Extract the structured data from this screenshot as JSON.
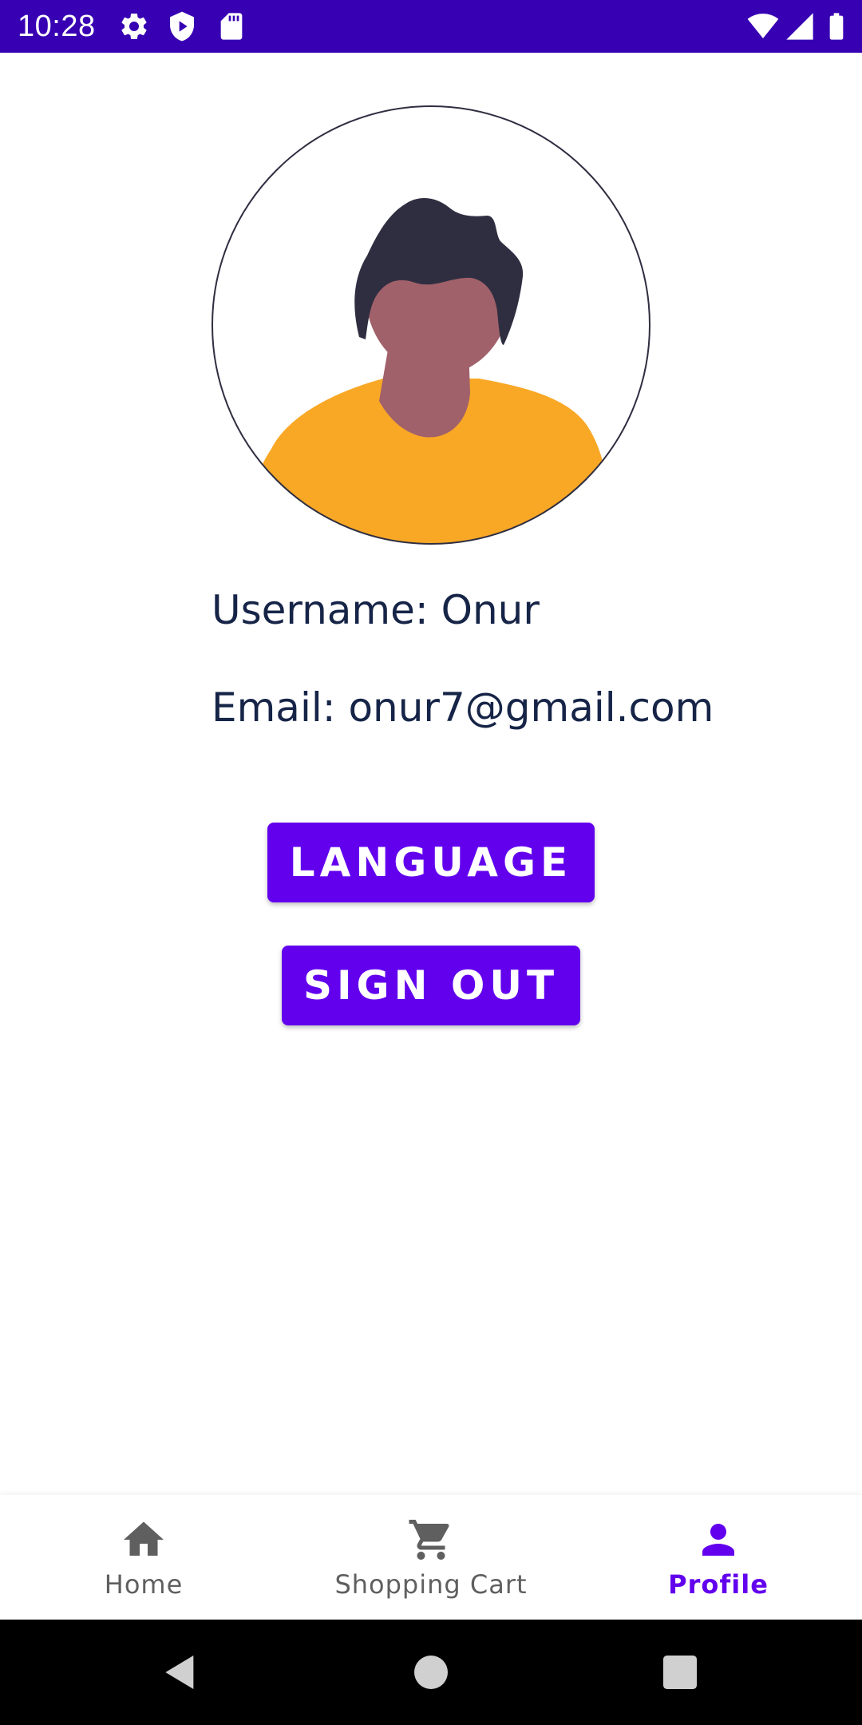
{
  "status_bar": {
    "time": "10:28",
    "background": "#3700b3",
    "left_icons": [
      "gear-icon",
      "shield-play-icon",
      "sd-card-icon"
    ],
    "right_icons": [
      "wifi-icon",
      "cell-signal-icon",
      "battery-icon"
    ]
  },
  "profile": {
    "avatar_icon": "person-avatar-illustration",
    "username_text": "Username: Onur",
    "email_text": "Email: onur7@gmail.com",
    "text_color": "#162447"
  },
  "actions": {
    "language_label": "LANGUAGE",
    "signout_label": "SIGN OUT",
    "button_color": "#6200ee"
  },
  "bottom_nav": {
    "items": [
      {
        "label": "Home",
        "icon": "home-icon",
        "active": false
      },
      {
        "label": "Shopping Cart",
        "icon": "cart-icon",
        "active": false
      },
      {
        "label": "Profile",
        "icon": "person-icon",
        "active": true
      }
    ],
    "active_color": "#6200ee",
    "inactive_color": "#5f5f5f"
  },
  "system_nav": {
    "buttons": [
      "back-icon",
      "home-circle-icon",
      "recents-icon"
    ]
  }
}
